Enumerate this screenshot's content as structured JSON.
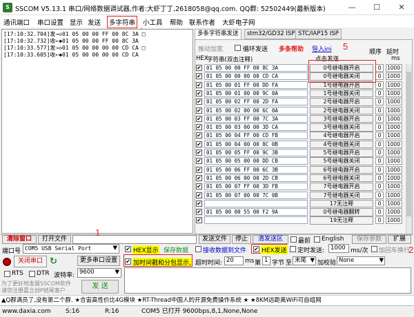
{
  "app": {
    "title": "SSCOM V5.13.1 串口/网络数据调试器,作者:大虾丁丁,2618058@qq.com. QQ群: 52502449(最新版本)",
    "logo": "S"
  },
  "menu": [
    "通讯端口",
    "串口设置",
    "显示",
    "发送",
    "多字符串",
    "小工具",
    "帮助",
    "联系作者",
    "大虾电子网"
  ],
  "annotations": {
    "n1": "1",
    "n2": "2",
    "n3": "3",
    "n4": "4",
    "n5": "5"
  },
  "receive_log": [
    "[17:10:32.704]发→◇01 05 00 00 FF 00 8C 3A □",
    "[17:10:32.732]收←◆01 05 00 00 FF 00 8C 3A",
    "[17:10:33.577]发→◇01 05 00 00 00 00 CD CA □",
    "[17:10:33.605]收←◆01 05 00 00 00 00 CD CA"
  ],
  "tabs": [
    "多条字符串发送",
    "stm32/GD32 ISP",
    "STC/IAP15 ISP"
  ],
  "multi": {
    "toolbar": {
      "loop_add": "推动加宽",
      "loop_send": "循环发送",
      "help": "多条帮助",
      "import": "导入ini",
      "order": "顺序",
      "delay": "延时"
    },
    "header": {
      "hex": "HEX",
      "string": "字符串(双击注释)",
      "click_send": "点击发送",
      "ms": "ms"
    },
    "rows": [
      {
        "hex": "01 05 00 00 FF 00 8C 3A",
        "label": "0号继电器开启",
        "seq": "0",
        "delay": "1000"
      },
      {
        "hex": "01 05 00 00 00 00 CD CA",
        "label": "0号继电器关闭",
        "seq": "0",
        "delay": "1000"
      },
      {
        "hex": "01 05 00 01 FF 00 DD FA",
        "label": "1号继电器开启",
        "seq": "0",
        "delay": "1000"
      },
      {
        "hex": "01 05 00 01 00 00 9C 0A",
        "label": "1号继电器关闭",
        "seq": "0",
        "delay": "1000"
      },
      {
        "hex": "01 05 00 02 FF 00 2D FA",
        "label": "2号继电器开启",
        "seq": "0",
        "delay": "1000"
      },
      {
        "hex": "01 05 00 02 00 00 6C 0A",
        "label": "2号继电器关闭",
        "seq": "0",
        "delay": "1000"
      },
      {
        "hex": "01 05 00 03 FF 00 7C 3A",
        "label": "3号继电器开启",
        "seq": "0",
        "delay": "1000"
      },
      {
        "hex": "01 05 00 03 00 00 3D CA",
        "label": "3号继电器关闭",
        "seq": "0",
        "delay": "1000"
      },
      {
        "hex": "01 05 00 04 FF 00 CD FB",
        "label": "4号继电器开启",
        "seq": "0",
        "delay": "1000"
      },
      {
        "hex": "01 05 00 04 00 00 8C 0B",
        "label": "4号继电器关闭",
        "seq": "0",
        "delay": "1000"
      },
      {
        "hex": "01 05 00 05 FF 00 9C 3B",
        "label": "5号继电器开启",
        "seq": "0",
        "delay": "1000"
      },
      {
        "hex": "01 05 00 05 00 00 DD CB",
        "label": "5号继电器关闭",
        "seq": "0",
        "delay": "1000"
      },
      {
        "hex": "01 05 00 06 FF 00 6C 3B",
        "label": "6号继电器开启",
        "seq": "0",
        "delay": "1000"
      },
      {
        "hex": "01 05 00 06 00 00 2D CB",
        "label": "6号继电器关闭",
        "seq": "0",
        "delay": "1000"
      },
      {
        "hex": "01 05 00 07 FF 00 3D FB",
        "label": "7号继电器开启",
        "seq": "0",
        "delay": "1000"
      },
      {
        "hex": "01 05 00 07 00 00 7C 0B",
        "label": "7号继电器关闭",
        "seq": "0",
        "delay": "1000"
      },
      {
        "hex": "",
        "label": "17无注释",
        "seq": "0",
        "delay": "1000"
      },
      {
        "hex": "01 05 00 00 55 00 F2 9A",
        "label": "0号继电器翻转",
        "seq": "0",
        "delay": "1000"
      },
      {
        "hex": "",
        "label": "19无注释",
        "seq": "0",
        "delay": "1000"
      }
    ]
  },
  "bottom": {
    "clear": "清除窗口",
    "open_file": "打开文件",
    "send_file": "发送文件",
    "stop": "停止",
    "clear_send": "清发送区",
    "front": "最前",
    "english": "English",
    "save_params": "保存参数",
    "expand": "扩展",
    "port_label": "端口号",
    "port_value": "COM5 USB Serial Port",
    "hex_show": "HEX显示",
    "save_data": "保存数据",
    "recv_to_file": "接收数据到文件",
    "hex_send": "HEX发送",
    "timed_send": "定时发送:",
    "interval": "1000",
    "interval_unit": "ms/次",
    "newline": "加回车换行",
    "close_port": "关闭串口",
    "more_settings": "更多串口设置",
    "timestamp": "加时间戳和分包显示,",
    "timeout_label": "超时时间:",
    "timeout": "20",
    "timeout_unit": "ms",
    "nth": "第",
    "byte_val": "1",
    "byte_label": "字节",
    "to": "至",
    "end": "末尾",
    "checksum": "加校验",
    "checksum_val": "None",
    "rts": "RTS",
    "dtr": "DTR",
    "baud_label": "波特率:",
    "baud": "9600",
    "send": "发 送",
    "promo1": "为了更好地发展SSCOM软件",
    "promo2": "请您注册嘉立创P结尾客户"
  },
  "ad": "▲Q群满员了,没有第二个群. ★合宙高性价比4G模块 ★RT-Thread中国人的开源免费操作系统 ★ ★8KM远距离WiFi可自组网",
  "status": {
    "site": "www.daxia.com",
    "s": "S:16",
    "r": "R:16",
    "port": "COM5 已打开  9600bps,8,1,None,None"
  },
  "colors": {
    "accent_red": "#e02020",
    "highlight_yellow": "#ffff00",
    "link_blue": "#0000cc",
    "green": "#1a8f1a"
  }
}
